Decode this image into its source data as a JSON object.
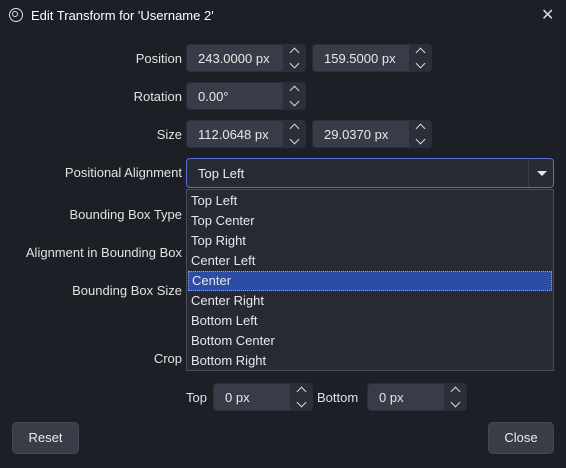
{
  "window": {
    "title": "Edit Transform for 'Username 2'"
  },
  "position": {
    "label": "Position",
    "x": "243.0000 px",
    "y": "159.5000 px"
  },
  "rotation": {
    "label": "Rotation",
    "value": "0.00°"
  },
  "size": {
    "label": "Size",
    "width": "112.0648 px",
    "height": "29.0370 px"
  },
  "positional_alignment": {
    "label": "Positional Alignment",
    "selected": "Top Left",
    "options": [
      "Top Left",
      "Top Center",
      "Top Right",
      "Center Left",
      "Center",
      "Center Right",
      "Bottom Left",
      "Bottom Center",
      "Bottom Right"
    ],
    "highlighted": "Center"
  },
  "bounding_box_type": {
    "label": "Bounding Box Type"
  },
  "alignment_in_bounding_box": {
    "label": "Alignment in Bounding Box"
  },
  "bounding_box_size": {
    "label": "Bounding Box Size"
  },
  "crop": {
    "label": "Crop",
    "top_label": "Top",
    "top_value": "0 px",
    "bottom_label": "Bottom",
    "bottom_value": "0 px"
  },
  "buttons": {
    "reset": "Reset",
    "close": "Close"
  },
  "icons": {
    "app": "obs-logo-icon",
    "close": "close-icon",
    "increment": "chevron-up-icon",
    "decrement": "chevron-down-icon",
    "dropdown": "dropdown-arrow-icon"
  },
  "colors": {
    "background": "#1d1f26",
    "field": "#393c48",
    "focus_border": "#5a6fd6",
    "selection": "#2c4da6"
  }
}
